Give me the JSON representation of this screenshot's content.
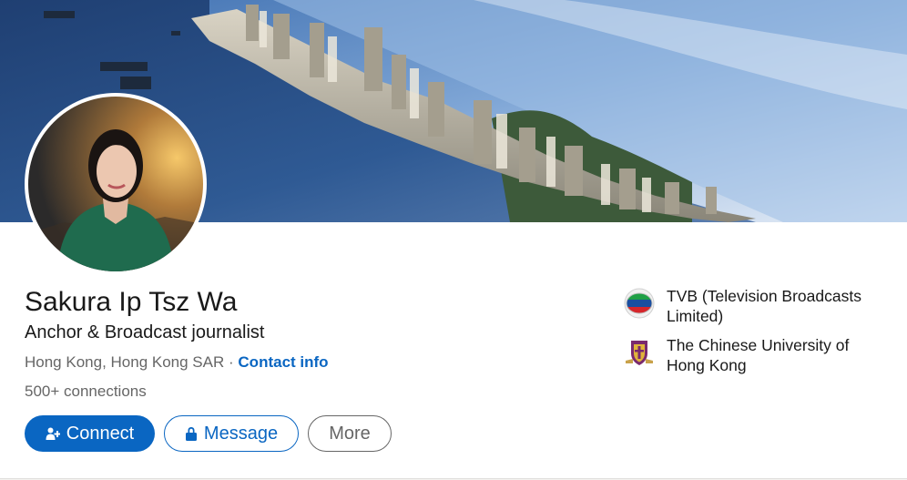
{
  "profile": {
    "name": "Sakura Ip Tsz Wa",
    "headline": "Anchor & Broadcast journalist",
    "location": "Hong Kong, Hong Kong SAR",
    "separator": "·",
    "contact_info_label": "Contact info",
    "connections": "500+ connections"
  },
  "actions": {
    "connect_label": "Connect",
    "message_label": "Message",
    "more_label": "More"
  },
  "organizations": [
    {
      "name": "TVB (Television Broadcasts Limited)",
      "logo": "tvb-logo-icon"
    },
    {
      "name": "The Chinese University of Hong Kong",
      "logo": "cuhk-crest-icon"
    }
  ],
  "colors": {
    "accent": "#0a66c2",
    "text_primary": "#191919",
    "text_secondary": "#666666"
  }
}
